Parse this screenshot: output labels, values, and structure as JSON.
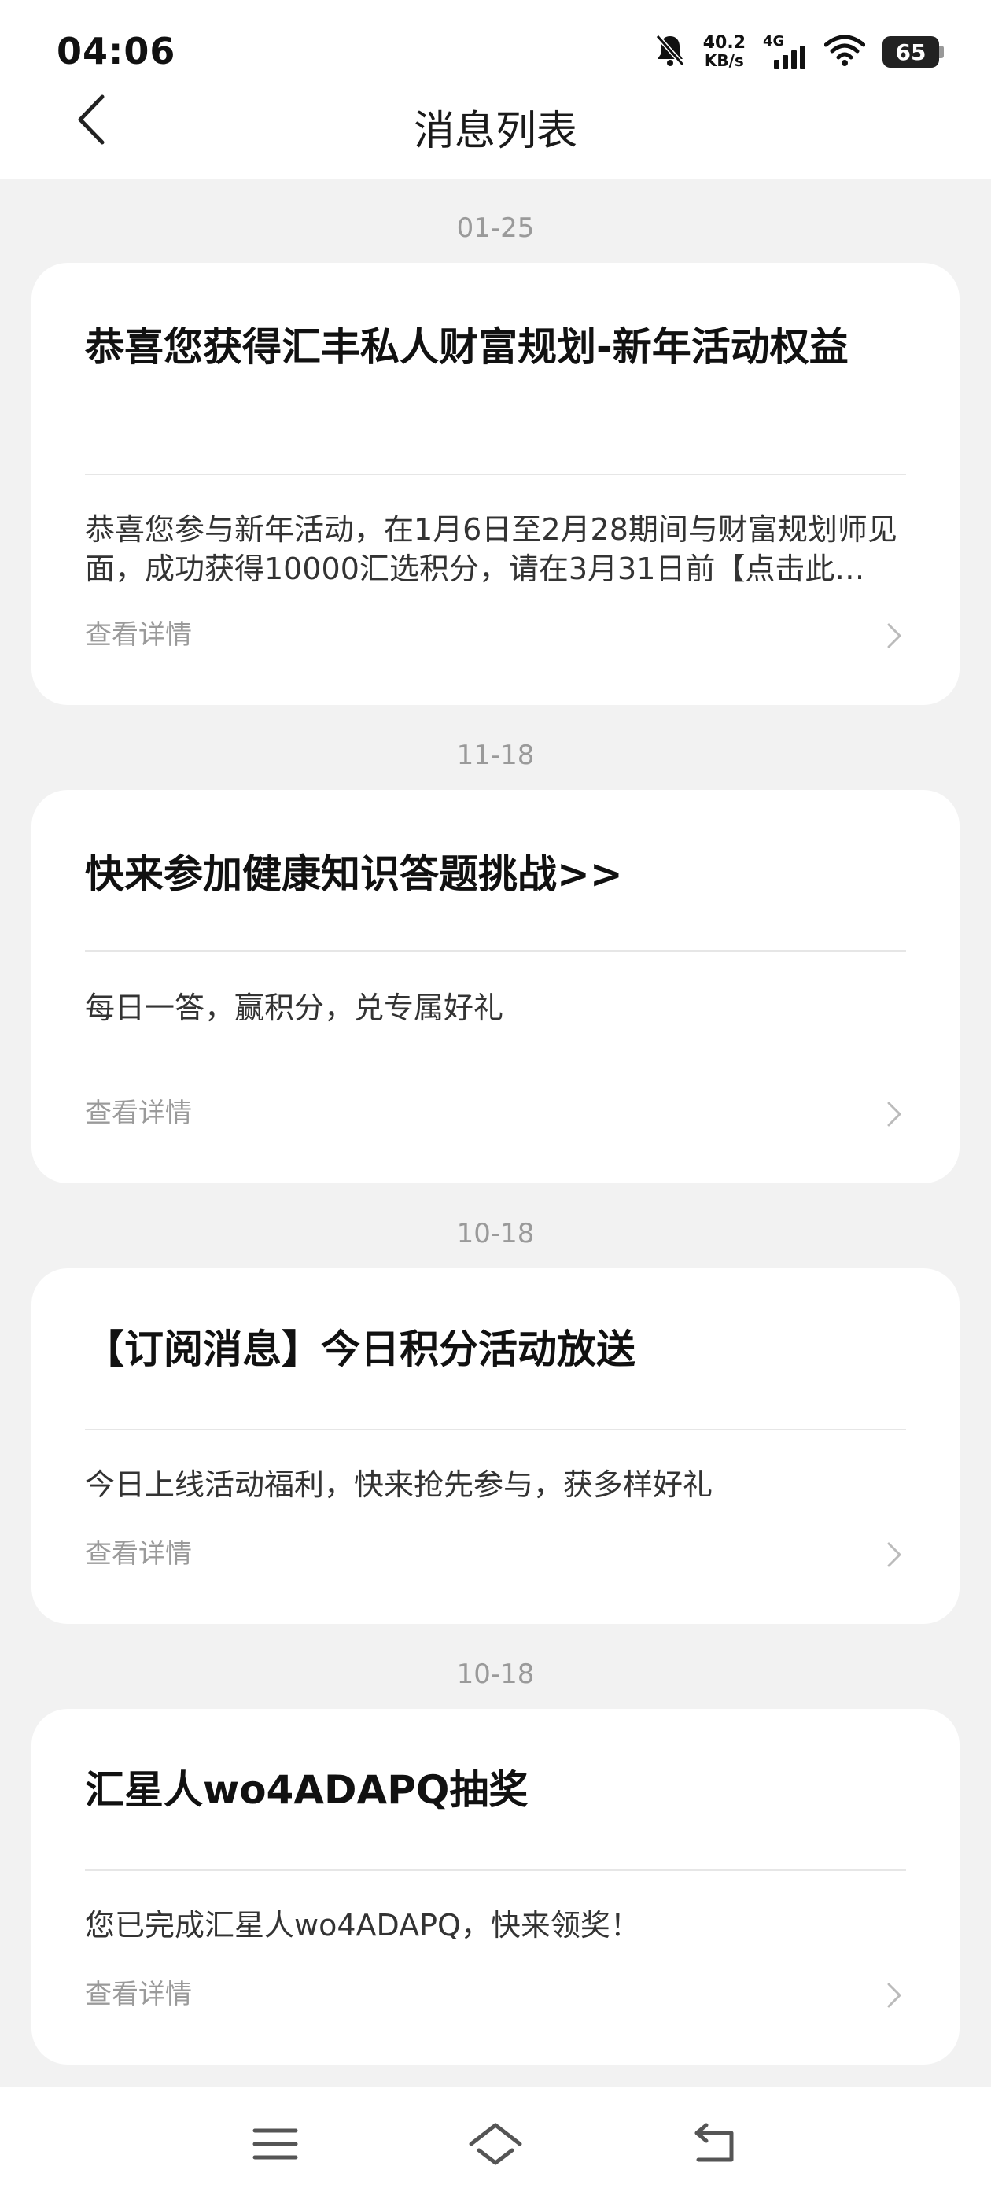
{
  "status_bar": {
    "time": "04:06",
    "net_speed_value": "40.2",
    "net_speed_unit": "KB/s",
    "network": "4G",
    "battery": "65",
    "icons": [
      "bell-muted-icon",
      "signal-icon",
      "wifi-icon",
      "battery-icon"
    ]
  },
  "header": {
    "title": "消息列表",
    "back_icon": "chevron-left-icon"
  },
  "messages": [
    {
      "date": "01-25",
      "title": "恭喜您获得汇丰私人财富规划-新年活动权益",
      "body": "恭喜您参与新年活动，在1月6日至2月28期间与财富规划师见面，成功获得10000汇选积分，请在3月31日前【点击此…",
      "detail": "查看详情"
    },
    {
      "date": "11-18",
      "title": "快来参加健康知识答题挑战>>",
      "body": "每日一答，赢积分，兑专属好礼",
      "detail": "查看详情"
    },
    {
      "date": "10-18",
      "title": "【订阅消息】今日积分活动放送",
      "body": "今日上线活动福利，快来抢先参与，获多样好礼",
      "detail": "查看详情"
    },
    {
      "date": "10-18",
      "title": "汇星人wo4ADAPQ抽奖",
      "body": "您已完成汇星人wo4ADAPQ，快来领奖！",
      "detail": "查看详情"
    }
  ],
  "nav": {
    "icons": [
      "menu-icon",
      "home-icon",
      "back-icon"
    ]
  },
  "colors": {
    "background": "#f2f2f2",
    "card": "#ffffff",
    "muted_text": "#9a9a9a"
  }
}
